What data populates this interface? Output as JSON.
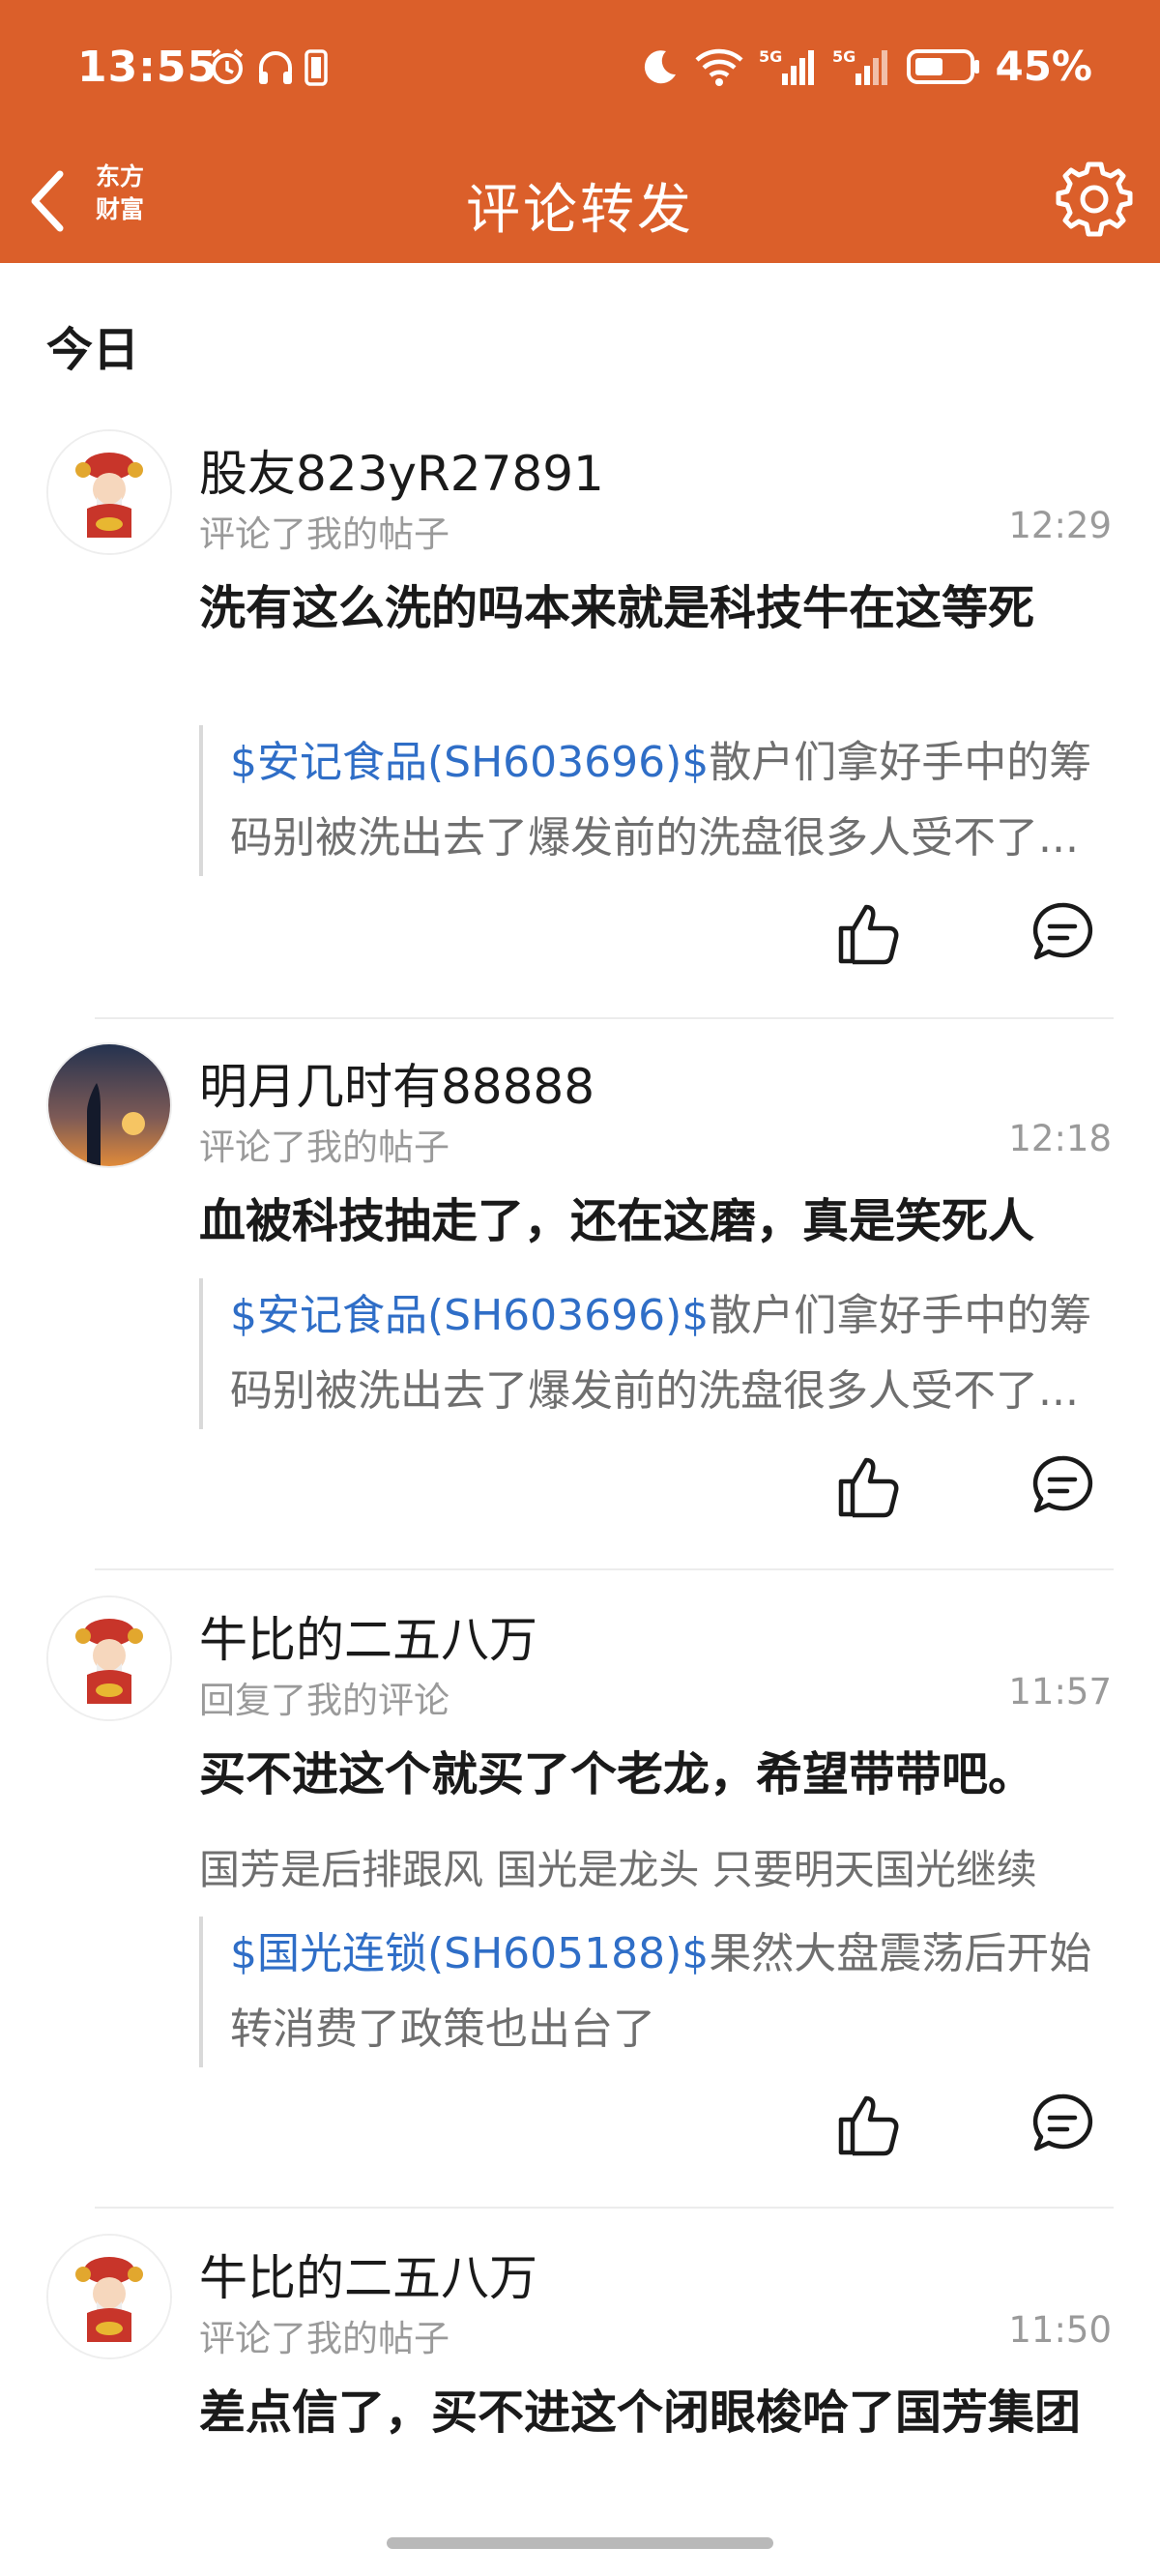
{
  "status": {
    "time": "13:55",
    "battery": "45%"
  },
  "nav": {
    "logo_line1": "东方",
    "logo_line2": "财富",
    "title": "评论转发"
  },
  "section_label": "今日",
  "items": [
    {
      "name": "股友823yR27891",
      "action": "评论了我的帖子",
      "time": "12:29",
      "content": "洗有这么洗的吗本来就是科技牛在这等死",
      "quote_tag": "$安记食品(SH603696)$",
      "quote_text": "散户们拿好手中的筹码别被洗出去了爆发前的洗盘很多人受不了..."
    },
    {
      "name": "明月几时有88888",
      "action": "评论了我的帖子",
      "time": "12:18",
      "content": "血被科技抽走了，还在这磨，真是笑死人",
      "quote_tag": "$安记食品(SH603696)$",
      "quote_text": "散户们拿好手中的筹码别被洗出去了爆发前的洗盘很多人受不了..."
    },
    {
      "name": "牛比的二五八万",
      "action": "回复了我的评论",
      "time": "11:57",
      "content": "买不进这个就买了个老龙，希望带带吧。",
      "reply": "国芳是后排跟风 国光是龙头   只要明天国光继续",
      "quote_tag": "$国光连锁(SH605188)$",
      "quote_text": "果然大盘震荡后开始转消费了政策也出台了"
    },
    {
      "name": "牛比的二五八万",
      "action": "评论了我的帖子",
      "time": "11:50",
      "content": "差点信了，买不进这个闭眼梭哈了国芳集团"
    }
  ],
  "colors": {
    "accent": "#db5f2a",
    "link": "#2f6ec7"
  }
}
